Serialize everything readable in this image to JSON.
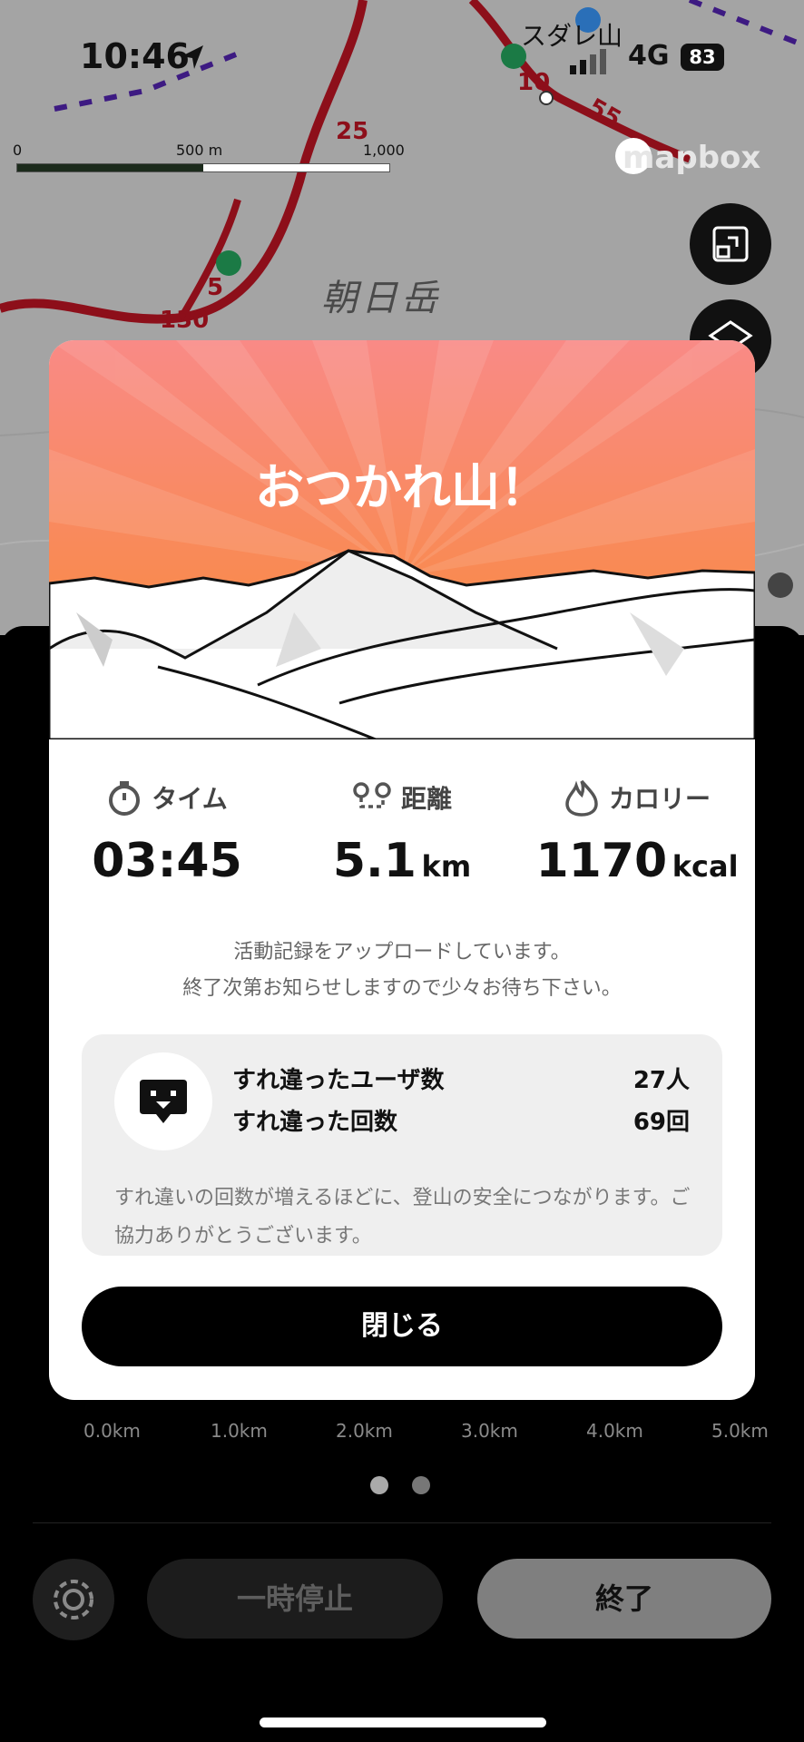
{
  "status_bar": {
    "time": "10:46",
    "network": "4G",
    "battery": "83"
  },
  "map": {
    "scale": {
      "label_0": "0",
      "label_500": "500 m",
      "label_1000": "1,000 m"
    },
    "attribution": "mapbox",
    "place_label_1": "朝日岳",
    "place_label_2": "スダレ山",
    "route_numbers": [
      "25",
      "5",
      "130",
      "10",
      "55"
    ]
  },
  "modal": {
    "title": "おつかれ山！",
    "stats": {
      "time": {
        "label": "タイム",
        "value": "03:45",
        "unit": ""
      },
      "distance": {
        "label": "距離",
        "value": "5.1",
        "unit": "km"
      },
      "calories": {
        "label": "カロリー",
        "value": "1170",
        "unit": "kcal"
      }
    },
    "upload_line1": "活動記録をアップロードしています。",
    "upload_line2": "終了次第お知らせしますので少々お待ち下さい。",
    "encounter": {
      "users_label": "すれ違ったユーザ数",
      "users_value": "27人",
      "count_label": "すれ違った回数",
      "count_value": "69回",
      "note": "すれ違いの回数が増えるほどに、登山の安全につながります。ご協力ありがとうございます。"
    },
    "close_label": "閉じる"
  },
  "elevation_axis": {
    "x_ticks": [
      "0.0km",
      "1.0km",
      "2.0km",
      "3.0km",
      "4.0km",
      "5.0km"
    ]
  },
  "controls": {
    "pause_label": "一時停止",
    "end_label": "終了"
  },
  "colors": {
    "hero_top": "#f98a86",
    "hero_bottom": "#f98a30",
    "accent": "#8d0f1a"
  }
}
